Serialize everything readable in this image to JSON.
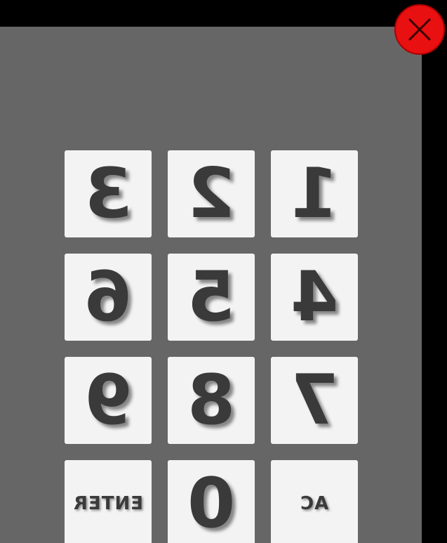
{
  "close_button": {
    "icon": "close-icon",
    "color": "#e81010"
  },
  "keypad": {
    "keys": [
      {
        "label": "3"
      },
      {
        "label": "2"
      },
      {
        "label": "1"
      },
      {
        "label": "6"
      },
      {
        "label": "5"
      },
      {
        "label": "4"
      },
      {
        "label": "9"
      },
      {
        "label": "8"
      },
      {
        "label": "7"
      },
      {
        "label": "ENTER"
      },
      {
        "label": "0"
      },
      {
        "label": "AC"
      }
    ],
    "mirrored": true
  },
  "colors": {
    "background": "#000000",
    "panel": "#666666",
    "key_face": "#f3f3f3",
    "key_text": "#3a3a3a"
  }
}
